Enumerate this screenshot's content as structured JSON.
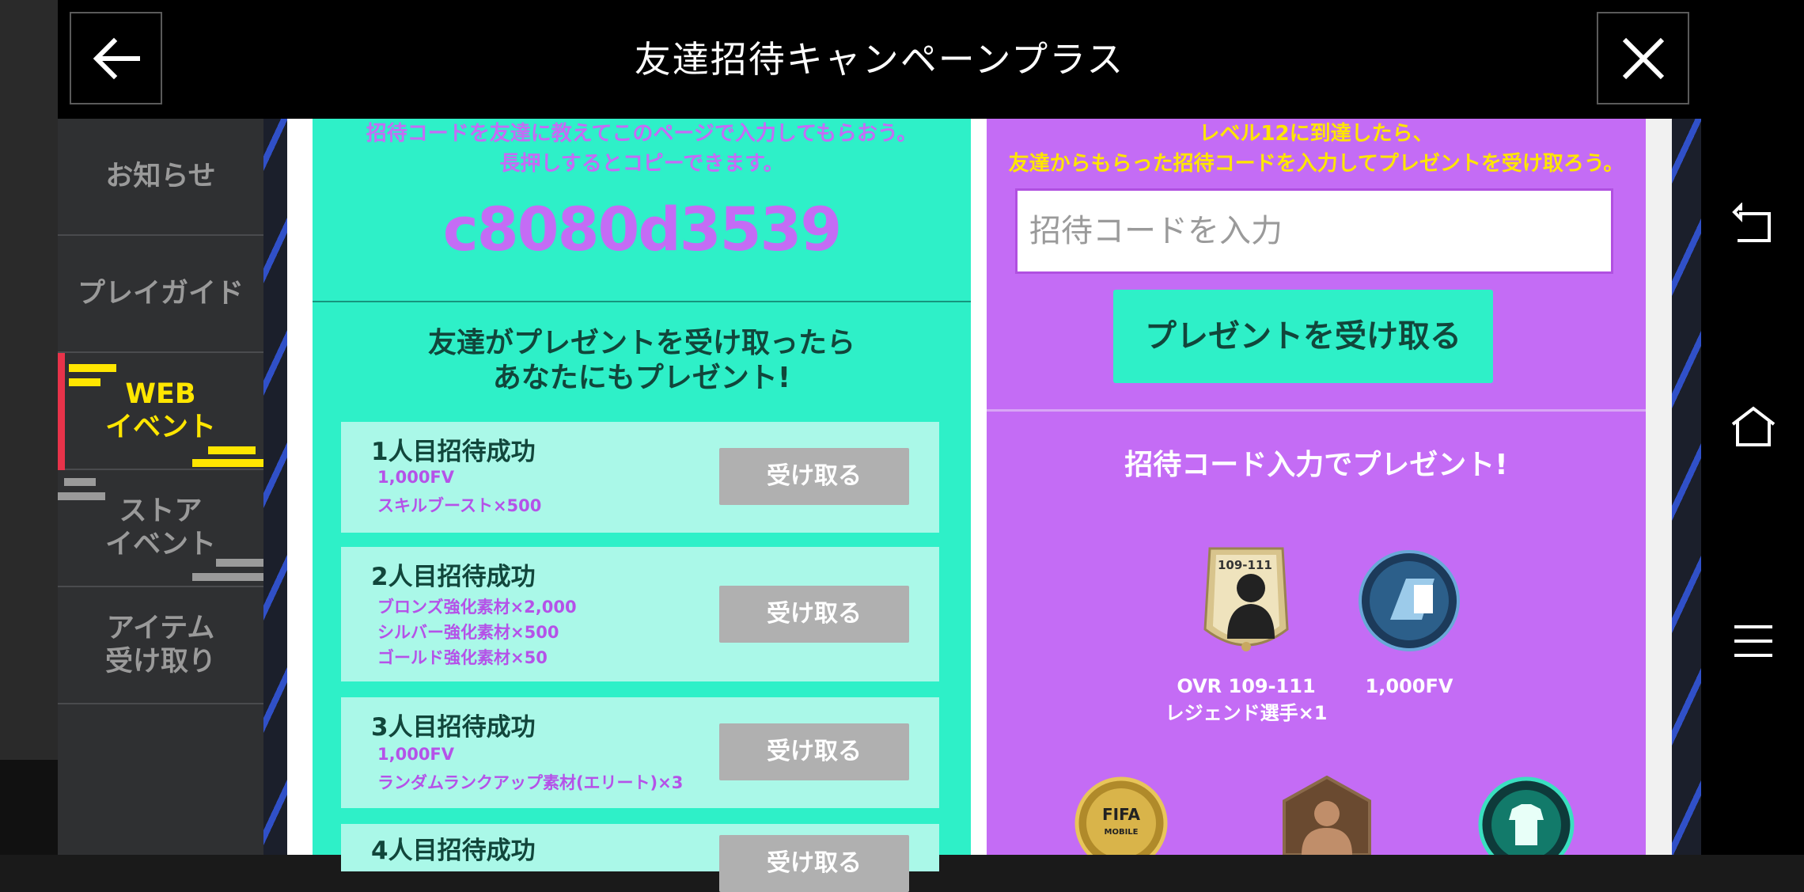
{
  "header": {
    "title": "友達招待キャンペーンプラス"
  },
  "sidebar": {
    "items": [
      {
        "label": "お知らせ"
      },
      {
        "label": "プレイガイド"
      },
      {
        "label_line1": "WEB",
        "label_line2": "イベント"
      },
      {
        "label_line1": "ストア",
        "label_line2": "イベント"
      },
      {
        "label_line1": "アイテム",
        "label_line2": "受け取り"
      }
    ]
  },
  "left_panel": {
    "instruction_line1": "招待コードを友達に教えてこのページで入力してもらおう。",
    "instruction_line2": "長押しするとコピーできます。",
    "invite_code": "c8080d3539",
    "heading_line1": "友達がプレゼントを受け取ったら",
    "heading_line2": "あなたにもプレゼント!",
    "rewards": [
      {
        "title": "1人目招待成功",
        "lines": [
          "1,000FV",
          "スキルブースト×500"
        ],
        "button": "受け取る"
      },
      {
        "title": "2人目招待成功",
        "lines": [
          "ブロンズ強化素材×2,000",
          "シルバー強化素材×500",
          "ゴールド強化素材×50"
        ],
        "button": "受け取る"
      },
      {
        "title": "3人目招待成功",
        "lines": [
          "1,000FV",
          "ランダムランクアップ素材(エリート)×3"
        ],
        "button": "受け取る"
      },
      {
        "title": "4人目招待成功",
        "lines": [],
        "button": "受け取る"
      }
    ]
  },
  "right_panel": {
    "instruction_line1": "レベル12に到達したら、",
    "instruction_line2": "友達からもらった招待コードを入力してプレゼントを受け取ろう。",
    "code_input_placeholder": "招待コードを入力",
    "receive_button": "プレゼントを受け取る",
    "heading": "招待コード入力でプレゼント!",
    "items": [
      {
        "icon": "legend-player-card-icon",
        "card_text": "109-111",
        "label_line1": "OVR 109-111",
        "label_line2": "レジェンド選手×1"
      },
      {
        "icon": "fifa-fv-coin-icon",
        "label_line1": "1,000FV",
        "label_line2": ""
      },
      {
        "icon": "fifa-mobile-coin-icon",
        "coin_text_line1": "FIFA",
        "coin_text_line2": "MOBILE"
      },
      {
        "icon": "player-silhouette-badge-icon"
      },
      {
        "icon": "kit-badge-icon"
      }
    ]
  },
  "colors": {
    "mint": "#2ef0c8",
    "mint_light": "#aaf8e8",
    "purple": "#c46cf5",
    "yellow": "#ffe600",
    "accent_red": "#e8334a",
    "button_gray": "#b0b0b0"
  },
  "system_nav": {
    "icons": [
      "back-nav-icon",
      "home-nav-icon",
      "menu-nav-icon"
    ]
  }
}
